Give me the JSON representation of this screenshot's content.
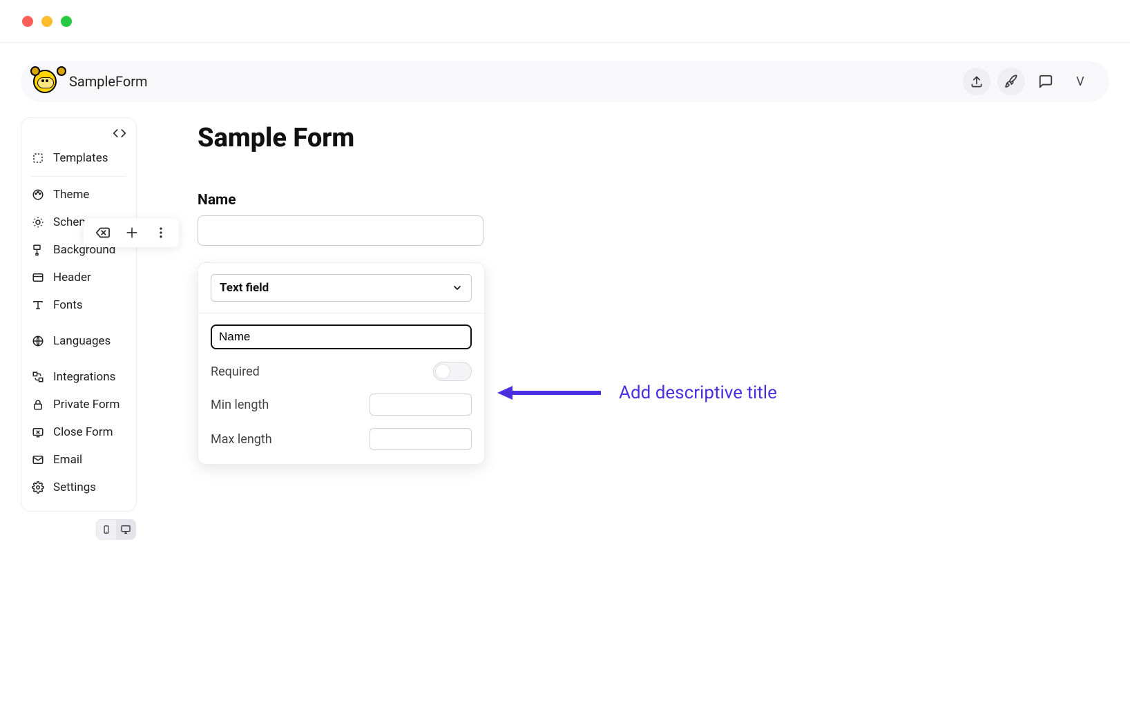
{
  "project_name": "SampleForm",
  "header_actions": {
    "avatar_initial": "V"
  },
  "sidebar": {
    "items": [
      {
        "label": "Templates"
      },
      {
        "label": "Theme"
      },
      {
        "label": "Scheme"
      },
      {
        "label": "Background"
      },
      {
        "label": "Header"
      },
      {
        "label": "Fonts"
      },
      {
        "label": "Languages"
      },
      {
        "label": "Integrations"
      },
      {
        "label": "Private Form"
      },
      {
        "label": "Close Form"
      },
      {
        "label": "Email"
      },
      {
        "label": "Settings"
      }
    ]
  },
  "form": {
    "title": "Sample Form",
    "field_label": "Name",
    "field_value": ""
  },
  "config": {
    "type_label": "Text field",
    "title_value": "Name",
    "required_label": "Required",
    "required_on": false,
    "min_label": "Min length",
    "min_value": "",
    "max_label": "Max length",
    "max_value": ""
  },
  "annotation": {
    "text": "Add descriptive title",
    "color": "#4a2fe0"
  }
}
